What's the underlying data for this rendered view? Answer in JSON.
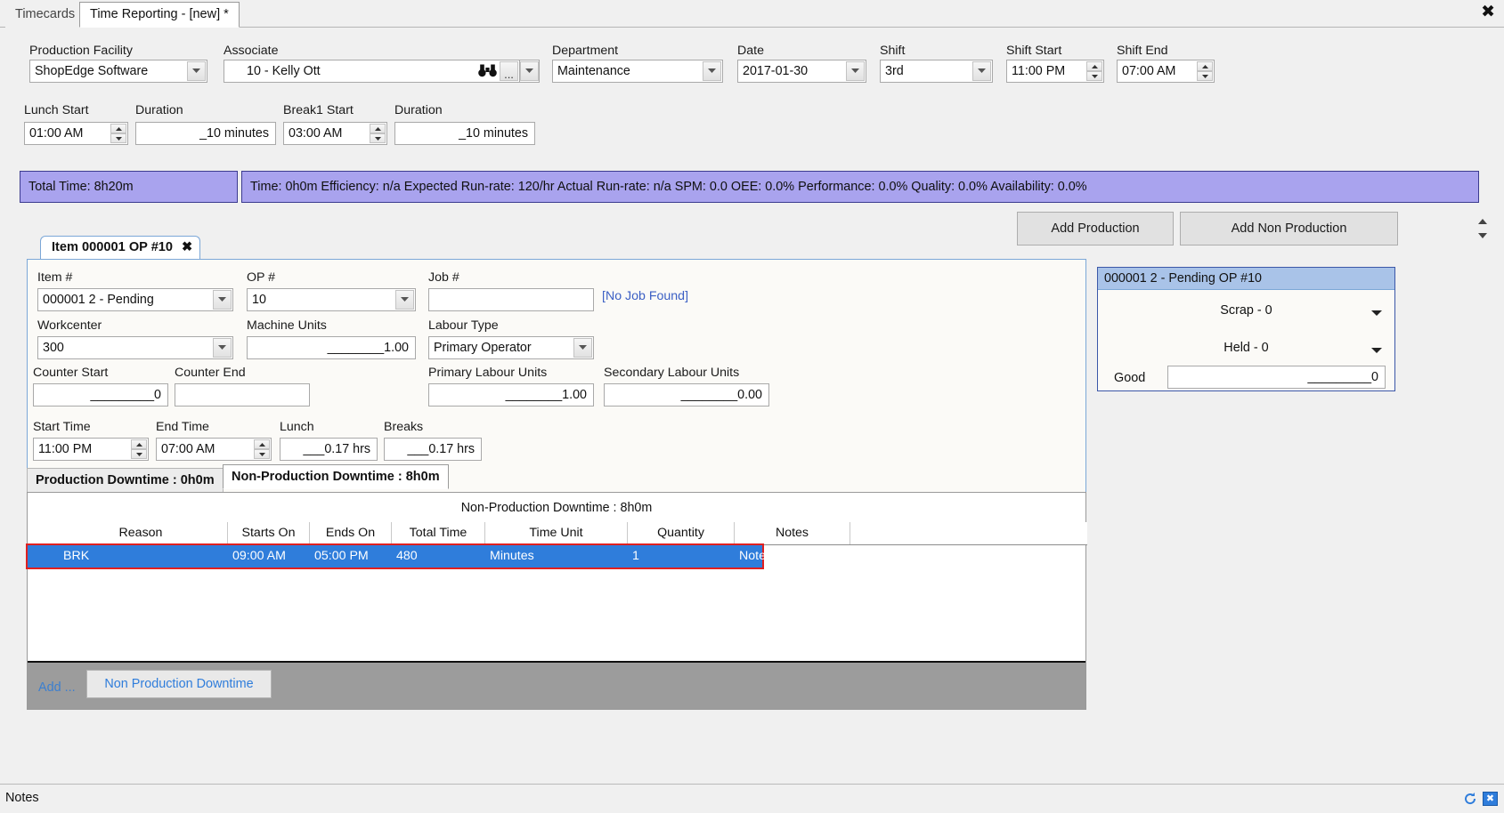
{
  "window": {
    "close_icon": "close-icon",
    "tabs": [
      {
        "label": "Timecards",
        "active": false
      },
      {
        "label": "Time Reporting - [new] *",
        "active": true
      }
    ]
  },
  "header": {
    "production_facility": {
      "label": "Production Facility",
      "value": "ShopEdge Software"
    },
    "associate": {
      "label": "Associate",
      "value": "10 - Kelly Ott",
      "find_icon": "binoculars-icon",
      "browse_label": "..."
    },
    "department": {
      "label": "Department",
      "value": "Maintenance"
    },
    "date": {
      "label": "Date",
      "value": "2017-01-30"
    },
    "shift": {
      "label": "Shift",
      "value": "3rd"
    },
    "shift_start": {
      "label": "Shift Start",
      "value": "11:00 PM"
    },
    "shift_end": {
      "label": "Shift End",
      "value": "07:00 AM"
    },
    "lunch_start": {
      "label": "Lunch Start",
      "value": "01:00 AM"
    },
    "lunch_duration": {
      "label": "Duration",
      "value": "_10 minutes"
    },
    "break1_start": {
      "label": "Break1 Start",
      "value": "03:00 AM"
    },
    "break1_duration": {
      "label": "Duration",
      "value": "_10 minutes"
    }
  },
  "summary": {
    "total_time": "Total Time: 8h20m",
    "stats": "Time: 0h0m  Efficiency: n/a  Expected Run-rate: 120/hr  Actual Run-rate: n/a  SPM: 0.0  OEE: 0.0%  Performance: 0.0%  Quality: 0.0%  Availability: 0.0%"
  },
  "toolbar": {
    "add_production": "Add Production",
    "add_non_production": "Add Non Production"
  },
  "item_tab": {
    "title": "Item 000001 OP #10",
    "close": "✖"
  },
  "item_form": {
    "item_no": {
      "label": "Item #",
      "value": "000001 2 - Pending"
    },
    "op_no": {
      "label": "OP #",
      "value": "10"
    },
    "job_no": {
      "label": "Job #",
      "value": "",
      "note": "[No Job Found]"
    },
    "workcenter": {
      "label": "Workcenter",
      "value": "300"
    },
    "machine_units": {
      "label": "Machine Units",
      "value": "________1.00"
    },
    "labour_type": {
      "label": "Labour Type",
      "value": "Primary Operator"
    },
    "counter_start": {
      "label": "Counter Start",
      "value": "_________0"
    },
    "counter_end": {
      "label": "Counter End",
      "value": ""
    },
    "primary_labour_units": {
      "label": "Primary Labour Units",
      "value": "________1.00"
    },
    "secondary_labour_units": {
      "label": "Secondary Labour Units",
      "value": "________0.00"
    },
    "start_time": {
      "label": "Start Time",
      "value": "11:00 PM"
    },
    "end_time": {
      "label": "End Time",
      "value": "07:00 AM"
    },
    "lunch": {
      "label": "Lunch",
      "value": "___0.17 hrs"
    },
    "breaks": {
      "label": "Breaks",
      "value": "___0.17 hrs"
    }
  },
  "quantity_panel": {
    "header": "000001 2 - Pending OP #10",
    "scrap": "Scrap - 0",
    "held": "Held - 0",
    "good_label": "Good",
    "good_value": "_________0"
  },
  "downtime": {
    "tab_production": "Production Downtime : 0h0m",
    "tab_non_production": "Non-Production Downtime : 8h0m",
    "grid_caption": "Non-Production Downtime : 8h0m",
    "columns": [
      "Reason",
      "Starts On",
      "Ends On",
      "Total Time",
      "Time Unit",
      "Quantity",
      "Notes"
    ],
    "rows": [
      {
        "selected": true,
        "marker": "✎",
        "cells": [
          "BRK",
          "09:00 AM",
          "05:00 PM",
          "480",
          "Minutes",
          "1",
          "Notes"
        ]
      }
    ],
    "add_link": "Add ...",
    "add_button": "Non Production Downtime"
  },
  "status": {
    "notes_label": "Notes",
    "refresh_icon": "refresh-icon",
    "close_icon": "close-panel-icon"
  },
  "colors": {
    "accent_blue": "#2f7ddb",
    "summary_bar": "#a9a3ee",
    "selection_outline": "#e02020",
    "link": "#3b5fc4"
  }
}
